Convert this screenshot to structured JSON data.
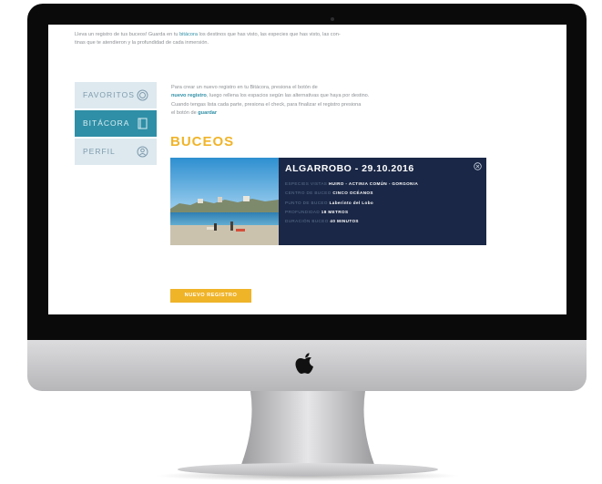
{
  "intro": {
    "text_before": "Lleva un registro de tus buceos! Guarda en tu ",
    "link": "bitácora",
    "text_after": " los destinos que has visto, las especies que has visto, las con-",
    "line2": "tinas que te atendieron y la profundidad de cada inmersión."
  },
  "sidebar": {
    "items": [
      {
        "label": "FAVORITOS",
        "icon": "favorites-icon"
      },
      {
        "label": "BITÁCORA",
        "icon": "logbook-icon"
      },
      {
        "label": "PERFIL",
        "icon": "profile-icon"
      }
    ]
  },
  "instructions": {
    "line1": "Para crear un nuevo registro en tu Bitácora, presiona el botón de",
    "link": "nuevo registro",
    "line2_rest": ", luego rellena los espacios según las alternativas que haya por destino.",
    "line3": "Cuando tengas lista cada parte, presiona el check, para finalizar el registro presiona",
    "line4_before": "el botón de ",
    "line4_link": "guardar"
  },
  "section_title": "BUCEOS",
  "dive": {
    "title": "ALGARROBO - 29.10.2016",
    "rows": [
      {
        "label": "ESPECIES VISTAS",
        "value": "HUIRO - ACTINIA COMÚN - GORGONIA"
      },
      {
        "label": "CENTRO DE BUCEO",
        "value": "CINCO OCÉANOS"
      },
      {
        "label": "PUNTO DE BUCEO",
        "value": "Laberinto del Lobo"
      },
      {
        "label": "PROFUNDIDAD",
        "value": "18 METROS"
      },
      {
        "label": "DURACIÓN BUCEO",
        "value": "40 MINUTOS"
      }
    ]
  },
  "new_entry_button": "NUEVO REGISTRO",
  "colors": {
    "accent": "#2f8fa6",
    "highlight": "#f0b429",
    "card": "#1a2746",
    "sidebar": "#dde9ef"
  }
}
